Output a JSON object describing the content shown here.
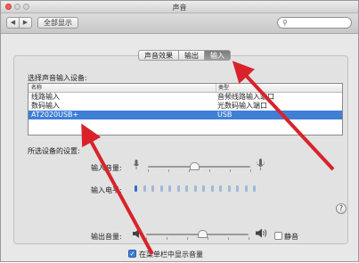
{
  "window": {
    "title": "声音"
  },
  "toolbar": {
    "back": "◀",
    "forward": "▶",
    "show_all": "全部显示",
    "search_placeholder": ""
  },
  "tabs": [
    {
      "label": "声音效果",
      "active": false
    },
    {
      "label": "输出",
      "active": false
    },
    {
      "label": "输入",
      "active": true
    }
  ],
  "input_section": {
    "heading": "选择声音输入设备:",
    "columns": [
      "名称",
      "类型"
    ],
    "rows": [
      {
        "name": "线路输入",
        "type": "音频线路输入端口",
        "selected": false
      },
      {
        "name": "数码输入",
        "type": "光数码输入端口",
        "selected": false
      },
      {
        "name": "AT2020USB+",
        "type": "USB",
        "selected": true
      }
    ]
  },
  "device_settings": {
    "heading": "所选设备的设置:",
    "input_volume_label": "输入音量:",
    "input_volume": 0.45,
    "input_level_label": "输入电平:",
    "input_level_segments": 15,
    "input_level_active": 1
  },
  "output": {
    "volume_label": "输出音量:",
    "volume": 0.55,
    "mute_label": "静音",
    "mute_checked": false,
    "menubar_label": "在菜单栏中显示音量",
    "menubar_checked": true
  },
  "help_label": "?",
  "colors": {
    "selection": "#3f7fd6",
    "arrow": "#d8232a",
    "level_active": "#2f6fd0",
    "level_inactive": "#9fb7db"
  }
}
